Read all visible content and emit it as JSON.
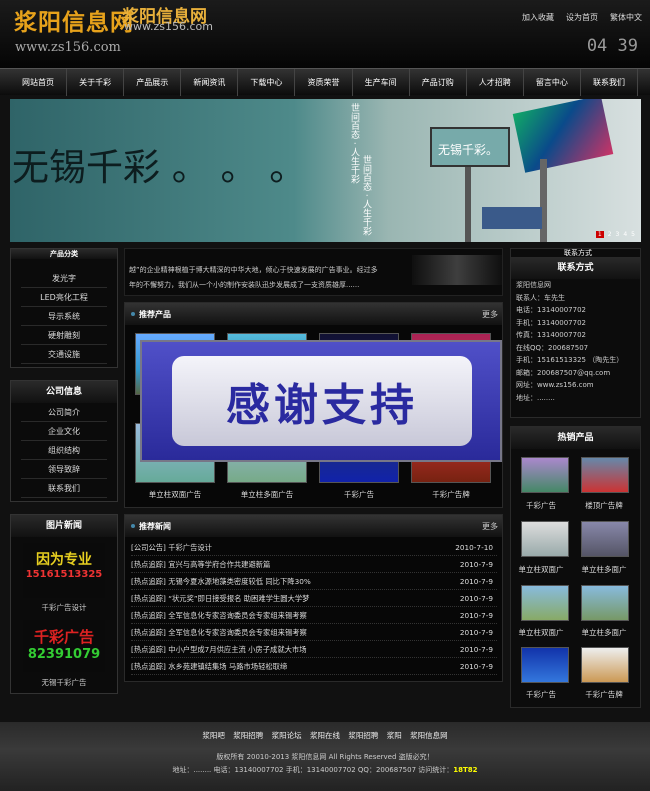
{
  "header": {
    "logo_text": "浆阳信息网",
    "logo_url": "www.zs156.com",
    "logo2_text": "浆阳信息网",
    "logo2_url": "www.zs156.com",
    "links": [
      "加入收藏",
      "设为首页",
      "繁体中文"
    ],
    "clock": "04 39"
  },
  "nav": [
    "网站首页",
    "关于千彩",
    "产品展示",
    "新闻资讯",
    "下载中心",
    "资质荣誉",
    "生产车间",
    "产品订购",
    "人才招聘",
    "留言中心",
    "联系我们"
  ],
  "banner": {
    "title": "无锡千彩 。 。 。",
    "vertical": "世间百态 · 人生千彩",
    "billboard": "无锡千彩。",
    "pages": [
      "1",
      "2",
      "3",
      "4",
      "5"
    ]
  },
  "left": {
    "products": [
      "发光字",
      "LED亮化工程",
      "导示系统",
      "硬射雕刻",
      "交通设施"
    ],
    "products_title": "产品分类",
    "company": {
      "title": "公司信息",
      "items": [
        "公司简介",
        "企业文化",
        "组织结构",
        "领导致辞",
        "联系我们"
      ]
    },
    "photo_news": {
      "title": "图片新闻",
      "img1_text": "因为专业",
      "img1_phone": "15161513325",
      "cap1": "千彩广告设计",
      "img2_text": "千彩广告",
      "img2_phone": "82391079",
      "cap2": "无锡千彩广告"
    }
  },
  "about": {
    "line1": "越”的企业精神根植于博大精深的中华大地，倾心于快速发展的广告事业。经过多",
    "line2": "年的不懈努力，我们从一个小的制作安装队迅步发展成了一支资质雄厚......"
  },
  "recommend": {
    "title": "推荐产品",
    "more": "更多",
    "captions": [
      "单立柱双面广告",
      "单立柱多面广告",
      "千彩广告",
      "千彩广告牌"
    ]
  },
  "overlay_text": "感谢支持",
  "latest_news": {
    "title": "推荐新闻",
    "more": "更多",
    "items": [
      {
        "text": "[公司公告] 千彩广告设计",
        "date": "2010-7-10"
      },
      {
        "text": "[热点追踪] 宜兴与高等学府合作共建避新篇",
        "date": "2010-7-9"
      },
      {
        "text": "[热点追踪] 无锡今夏水源地藻类密度较低 同比下降30%",
        "date": "2010-7-9"
      },
      {
        "text": "[热点追踪] “状元奖”即日接受报名 助困难学生圆大学梦",
        "date": "2010-7-9"
      },
      {
        "text": "[热点追踪] 全军信息化专家咨询委员会专家组来锡考察",
        "date": "2010-7-9"
      },
      {
        "text": "[热点追踪] 全军信息化专家咨询委员会专家组来锡考察",
        "date": "2010-7-9"
      },
      {
        "text": "[热点追踪] 中小户型成7月供应主流 小房子成就大市场",
        "date": "2010-7-9"
      },
      {
        "text": "[热点追踪] 水乡苑建镇结集场 马路市场轻松取缔",
        "date": "2010-7-9"
      }
    ]
  },
  "contact": {
    "top_label": "联系方式",
    "title": "联系方式",
    "lines": [
      "浆阳信息网",
      "联系人：车先生",
      "电话：13140007702",
      "手机：13140007702",
      "传真：13140007702",
      "在线QQ：200687507",
      "手机：15161513325 （陶先生）",
      "邮箱：200687507@qq.com",
      "网址：www.zs156.com",
      "地址：........"
    ]
  },
  "hot": {
    "title": "热销产品",
    "captions": [
      "千彩广告",
      "楼顶广告牌",
      "单立柱双面广",
      "单立柱多面广",
      "单立柱双面广",
      "单立柱多面广",
      "千彩广告",
      "千彩广告牌"
    ]
  },
  "footer": {
    "links": [
      "浆阳吧",
      "浆阳招聘",
      "浆阳论坛",
      "浆阳在线",
      "浆阳招聘",
      "浆阳",
      "浆阳信息网"
    ],
    "copyright": "版权所有 20010-2013 浆阳信息网 All Rights Reserved 盗版必究！",
    "address": "地址：........  电话：13140007702 手机：13140007702 QQ：200687507 访问统计：",
    "visits": "18T82"
  }
}
